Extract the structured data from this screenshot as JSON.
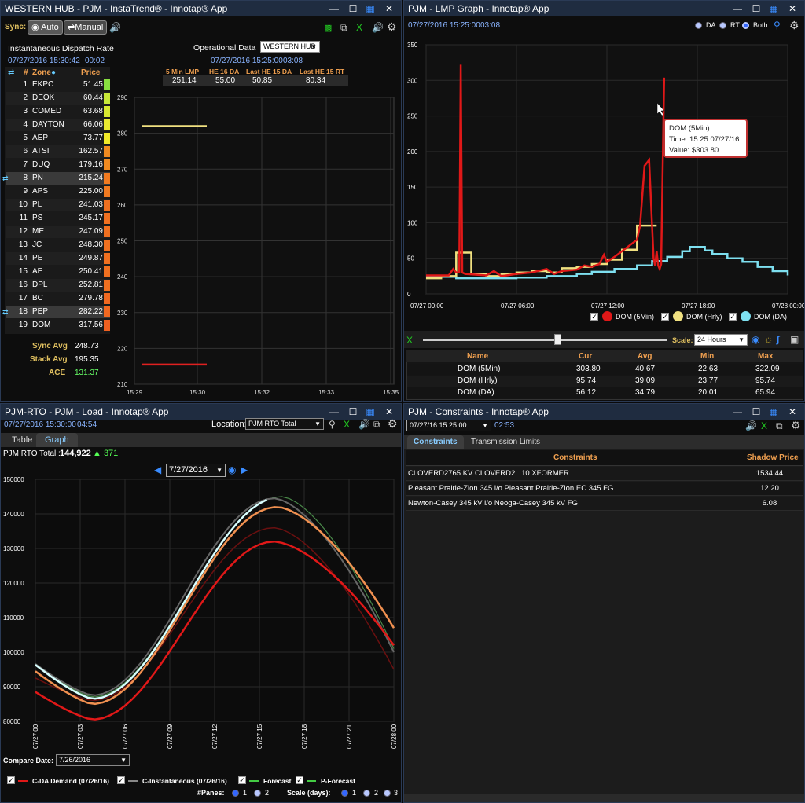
{
  "w1": {
    "title": "WESTERN HUB - PJM - InstaTrend® - Innotap® App",
    "sync_label": "Sync:",
    "auto": "Auto",
    "manual": "Manual",
    "rate_title": "Instantaneous Dispatch Rate",
    "rate_time": "07/27/2016 15:30:42",
    "rate_age": "00:02",
    "op_title": "Operational Data",
    "op_select": "WESTERN HUB",
    "op_time": "07/27/2016 15:25:00",
    "op_age": "03:08",
    "op_cols": [
      "5 Min LMP",
      "HE 16 DA",
      "Last HE 15 DA",
      "Last HE 15 RT"
    ],
    "op_vals": [
      "251.14",
      "55.00",
      "50.85",
      "80.34"
    ],
    "zone_hdr": {
      "num": "#",
      "zone": "Zone",
      "price": "Price"
    },
    "zones": [
      {
        "n": "1",
        "z": "EKPC",
        "p": "51.45",
        "c": "#88e040"
      },
      {
        "n": "2",
        "z": "DEOK",
        "p": "60.44",
        "c": "#c8e838"
      },
      {
        "n": "3",
        "z": "COMED",
        "p": "63.68",
        "c": "#d8e830"
      },
      {
        "n": "4",
        "z": "DAYTON",
        "p": "66.06",
        "c": "#e8e830"
      },
      {
        "n": "5",
        "z": "AEP",
        "p": "73.77",
        "c": "#f0e828"
      },
      {
        "n": "6",
        "z": "ATSI",
        "p": "162.57",
        "c": "#f08a20"
      },
      {
        "n": "7",
        "z": "DUQ",
        "p": "179.16",
        "c": "#f08a20"
      },
      {
        "n": "8",
        "z": "PN",
        "p": "215.24",
        "c": "#f07a20"
      },
      {
        "n": "9",
        "z": "APS",
        "p": "225.00",
        "c": "#f07a20"
      },
      {
        "n": "10",
        "z": "PL",
        "p": "241.03",
        "c": "#f07020"
      },
      {
        "n": "11",
        "z": "PS",
        "p": "245.17",
        "c": "#f07020"
      },
      {
        "n": "12",
        "z": "ME",
        "p": "247.09",
        "c": "#f07020"
      },
      {
        "n": "13",
        "z": "JC",
        "p": "248.30",
        "c": "#f07020"
      },
      {
        "n": "14",
        "z": "PE",
        "p": "249.87",
        "c": "#f07020"
      },
      {
        "n": "15",
        "z": "AE",
        "p": "250.41",
        "c": "#f07020"
      },
      {
        "n": "16",
        "z": "DPL",
        "p": "252.81",
        "c": "#f07020"
      },
      {
        "n": "17",
        "z": "BC",
        "p": "279.78",
        "c": "#f06820"
      },
      {
        "n": "18",
        "z": "PEP",
        "p": "282.22",
        "c": "#f06820"
      },
      {
        "n": "19",
        "z": "DOM",
        "p": "317.56",
        "c": "#f06020"
      }
    ],
    "sync_avg_l": "Sync Avg",
    "sync_avg": "248.73",
    "stack_avg_l": "Stack Avg",
    "stack_avg": "195.35",
    "ace_l": "ACE",
    "ace": "131.37",
    "chart": {
      "yticks": [
        "290",
        "280",
        "270",
        "260",
        "250",
        "240",
        "230",
        "220",
        "210"
      ],
      "xticks": [
        "15:29",
        "15:30",
        "15:32",
        "15:33",
        "15:35"
      ]
    }
  },
  "chart_data": [
    {
      "type": "line",
      "title": "InstaTrend",
      "series": [
        {
          "values": [
            282,
            282
          ]
        },
        {
          "values": [
            215.5,
            215.5
          ]
        }
      ],
      "x": [
        "15:29",
        "15:30"
      ],
      "ylim": [
        210,
        290
      ]
    },
    {
      "type": "line",
      "title": "LMP Graph",
      "x_range": [
        "07/27 00:00",
        "07/28 00:00"
      ],
      "ylim": [
        0,
        350
      ],
      "series": [
        {
          "name": "DOM (5Min)",
          "cur": 303.8,
          "avg": 40.67,
          "min": 22.63,
          "max": 322.09
        },
        {
          "name": "DOM (Hrly)",
          "cur": 95.74,
          "avg": 39.09,
          "min": 23.77,
          "max": 95.74
        },
        {
          "name": "DOM (DA)",
          "cur": 56.12,
          "avg": 34.79,
          "min": 20.01,
          "max": 65.94
        }
      ]
    },
    {
      "type": "line",
      "title": "PJM RTO Load",
      "ylim": [
        80000,
        150000
      ],
      "series": [
        {
          "name": "C-DA Demand (07/26/16)"
        },
        {
          "name": "C-Instantaneous (07/26/16)"
        },
        {
          "name": "Forecast"
        },
        {
          "name": "P-Forecast"
        }
      ]
    }
  ],
  "w2": {
    "title": "PJM - LMP Graph - Innotap® App",
    "time": "07/27/2016 15:25:00",
    "age": "03:08",
    "da": "DA",
    "rt": "RT",
    "both": "Both",
    "yticks": [
      "350",
      "300",
      "250",
      "200",
      "150",
      "100",
      "50",
      "0"
    ],
    "xticks": [
      "07/27 00:00",
      "07/27 06:00",
      "07/27 12:00",
      "07/27 18:00",
      "07/28 00:00"
    ],
    "tip": {
      "l1": "DOM (5Min)",
      "l2": "Time: 15:25 07/27/16",
      "l3": "Value: $303.80"
    },
    "legend": [
      "DOM (5Min)",
      "DOM (Hrly)",
      "DOM (DA)"
    ],
    "scale_l": "Scale:",
    "scale": "24 Hours",
    "cols": [
      "Name",
      "Cur",
      "Avg",
      "Min",
      "Max"
    ],
    "rows": [
      [
        "DOM (5Min)",
        "303.80",
        "40.67",
        "22.63",
        "322.09"
      ],
      [
        "DOM (Hrly)",
        "95.74",
        "39.09",
        "23.77",
        "95.74"
      ],
      [
        "DOM (DA)",
        "56.12",
        "34.79",
        "20.01",
        "65.94"
      ]
    ]
  },
  "w3": {
    "title": "PJM-RTO - PJM - Load - Innotap® App",
    "time": "07/27/2016 15:30:00",
    "age": "04:54",
    "loc_l": "Location:",
    "loc": "PJM RTO Total",
    "tab_table": "Table",
    "tab_graph": "Graph",
    "total_l": "PJM RTO Total :",
    "total": "144,922",
    "delta": "▲ 371",
    "date": "7/27/2016",
    "yticks": [
      "150000",
      "140000",
      "130000",
      "120000",
      "110000",
      "100000",
      "90000",
      "80000"
    ],
    "xticks": [
      "07/27 00",
      "07/27 03",
      "07/27 06",
      "07/27 09",
      "07/27 12",
      "07/27 15",
      "07/27 18",
      "07/27 21",
      "07/28 00"
    ],
    "cmp_l": "Compare Date:",
    "cmp": "7/26/2016",
    "leg": [
      "C-DA Demand (07/26/16)",
      "C-Instantaneous (07/26/16)",
      "Forecast",
      "P-Forecast"
    ],
    "panes_l": "#Panes:",
    "panes": [
      "1",
      "2"
    ],
    "scale_l": "Scale (days):",
    "scale": [
      "1",
      "2",
      "3"
    ]
  },
  "w4": {
    "title": "PJM - Constraints - Innotap® App",
    "time": "07/27/16 15:25:00",
    "age": "02:53",
    "tab1": "Constraints",
    "tab2": "Transmission Limits",
    "col1": "Constraints",
    "col2": "Shadow Price",
    "rows": [
      [
        "CLOVERD2765 KV  CLOVERD2 . 10     XFORMER",
        "1534.44"
      ],
      [
        "Pleasant Prairie-Zion 345 l/o Pleasant Prairie-Zion EC 345 FG",
        "12.20"
      ],
      [
        "Newton-Casey 345 kV l/o Neoga-Casey 345 kV FG",
        "6.08"
      ]
    ]
  }
}
